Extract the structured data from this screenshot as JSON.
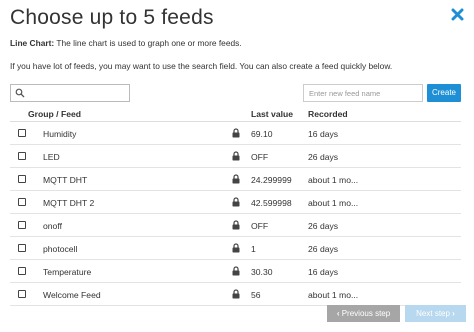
{
  "header": {
    "title": "Choose up to 5 feeds",
    "close_color": "#1e8fd4"
  },
  "description": {
    "label": "Line Chart:",
    "text": " The line chart is used to graph one or more feeds."
  },
  "hint": "If you have lot of feeds, you may want to use the search field. You can also create a feed quickly below.",
  "search": {
    "value": "",
    "icon": "search-icon"
  },
  "new_feed": {
    "placeholder": "Enter new feed name",
    "create_label": "Create",
    "accent": "#1e8fd4"
  },
  "table": {
    "columns": [
      "Group / Feed",
      "Last value",
      "Recorded"
    ],
    "rows": [
      {
        "name": "Humidity",
        "value": "69.10",
        "recorded": "16 days"
      },
      {
        "name": "LED",
        "value": "OFF",
        "recorded": "26 days"
      },
      {
        "name": "MQTT DHT",
        "value": "24.299999",
        "recorded": "about 1 mo..."
      },
      {
        "name": "MQTT DHT 2",
        "value": "42.599998",
        "recorded": "about 1 mo..."
      },
      {
        "name": "onoff",
        "value": "OFF",
        "recorded": "26 days"
      },
      {
        "name": "photocell",
        "value": "1",
        "recorded": "26 days"
      },
      {
        "name": "Temperature",
        "value": "30.30",
        "recorded": "16 days"
      },
      {
        "name": "Welcome Feed",
        "value": "56",
        "recorded": "about 1 mo..."
      }
    ]
  },
  "footer": {
    "prev_label": "Previous step",
    "prev_chevron": "‹",
    "next_label": "Next step",
    "next_chevron": "›"
  }
}
